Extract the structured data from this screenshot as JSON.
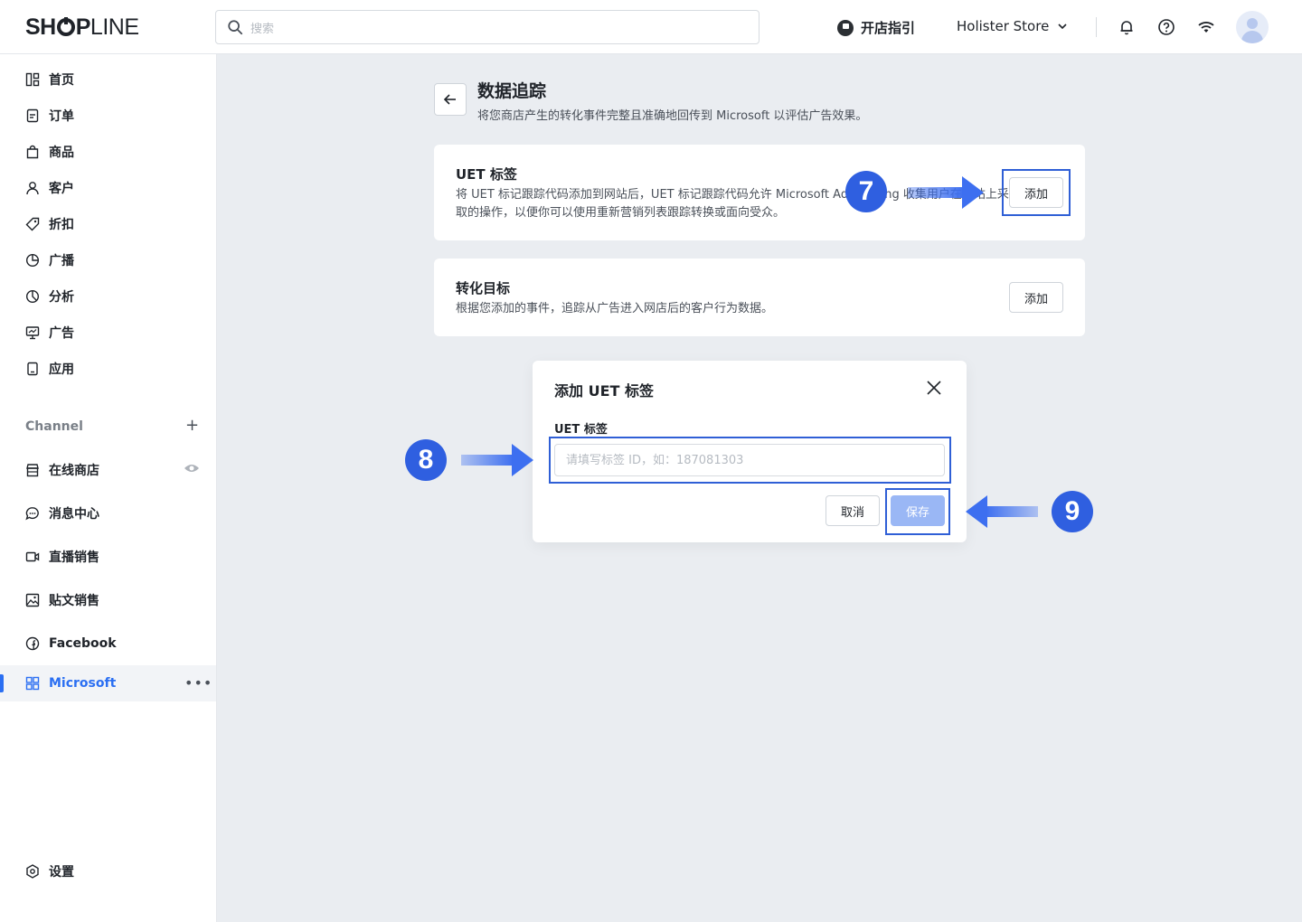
{
  "header": {
    "logo_bold": "SH",
    "logo_bold2": "P",
    "logo_light": "LINE",
    "search_placeholder": "搜索",
    "guide_label": "开店指引",
    "store_name": "Holister Store"
  },
  "sidebar": {
    "items": [
      {
        "label": "首页",
        "icon": "home-icon"
      },
      {
        "label": "订单",
        "icon": "order-icon"
      },
      {
        "label": "商品",
        "icon": "bag-icon"
      },
      {
        "label": "客户",
        "icon": "user-icon"
      },
      {
        "label": "折扣",
        "icon": "tag-icon"
      },
      {
        "label": "广播",
        "icon": "broadcast-icon"
      },
      {
        "label": "分析",
        "icon": "analytics-icon"
      },
      {
        "label": "广告",
        "icon": "ads-icon"
      },
      {
        "label": "应用",
        "icon": "apps-icon"
      }
    ],
    "channel_title": "Channel",
    "channels": [
      {
        "label": "在线商店",
        "icon": "store-icon"
      },
      {
        "label": "消息中心",
        "icon": "message-icon"
      },
      {
        "label": "直播销售",
        "icon": "video-icon"
      },
      {
        "label": "贴文销售",
        "icon": "image-icon"
      },
      {
        "label": "Facebook",
        "icon": "facebook-icon"
      },
      {
        "label": "Microsoft",
        "icon": "microsoft-icon"
      }
    ],
    "settings_label": "设置"
  },
  "page": {
    "title": "数据追踪",
    "description": "将您商店产生的转化事件完整且准确地回传到 Microsoft 以评估广告效果。"
  },
  "cards": {
    "uet": {
      "title": "UET 标签",
      "desc_line1": "将 UET 标记跟踪代码添加到网站后，UET 标记跟踪代码允许 Microsoft Advertising 收集用户在网站上采",
      "desc_line2": "取的操作，以便你可以使用重新营销列表跟踪转换或面向受众。",
      "button": "添加"
    },
    "conversion": {
      "title": "转化目标",
      "desc": "根据您添加的事件，追踪从广告进入网店后的客户行为数据。",
      "button": "添加"
    }
  },
  "modal": {
    "title": "添加 UET 标签",
    "field_label": "UET 标签",
    "input_placeholder": "请填写标签 ID，如：187081303",
    "input_value": "",
    "cancel": "取消",
    "save": "保存"
  },
  "steps": [
    "7",
    "8",
    "9"
  ],
  "colors": {
    "accent": "#2b6ff2",
    "step_marker": "#2f5fe0",
    "highlight_border": "#2f5fd6",
    "save_disabled": "#9ab7f5"
  }
}
